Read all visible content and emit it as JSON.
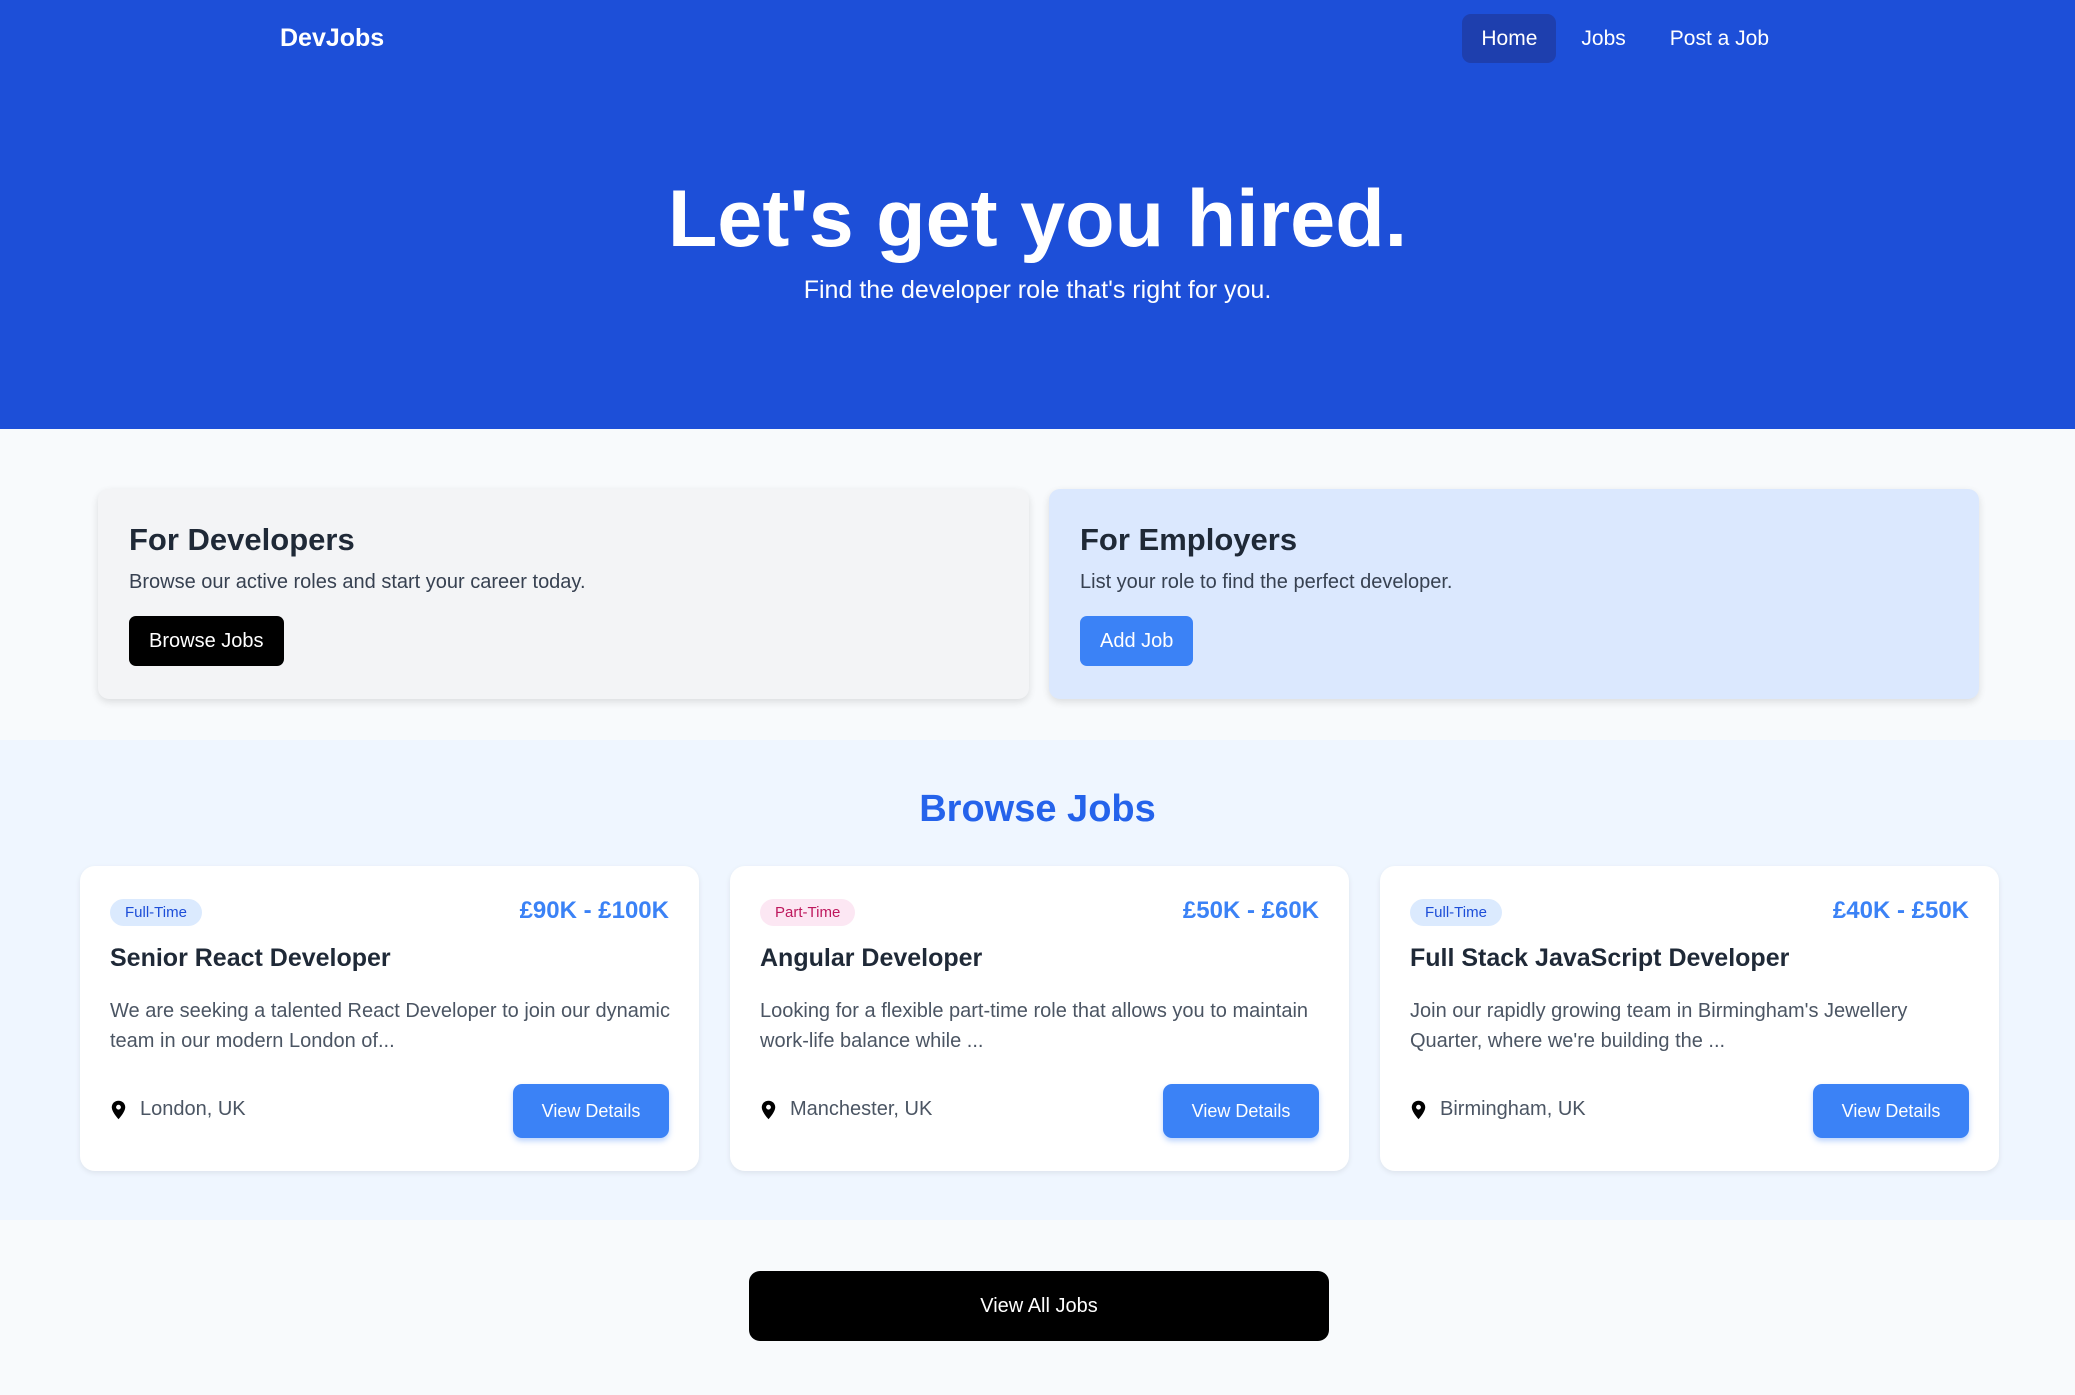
{
  "header": {
    "brand": "DevJobs",
    "nav": [
      {
        "label": "Home",
        "active": true
      },
      {
        "label": "Jobs",
        "active": false
      },
      {
        "label": "Post a Job",
        "active": false
      }
    ]
  },
  "hero": {
    "title": "Let's get you hired.",
    "subtitle": "Find the developer role that's right for you."
  },
  "roles": {
    "developers": {
      "title": "For Developers",
      "description": "Browse our active roles and start your career today.",
      "button": "Browse Jobs"
    },
    "employers": {
      "title": "For Employers",
      "description": "List your role to find the perfect developer.",
      "button": "Add Job"
    }
  },
  "browse": {
    "title": "Browse Jobs",
    "jobs": [
      {
        "type": "Full-Time",
        "salary": "£90K - £100K",
        "title": "Senior React Developer",
        "description": "We are seeking a talented React Developer to join our dynamic team in our modern London of...",
        "location": "London, UK",
        "button": "View Details"
      },
      {
        "type": "Part-Time",
        "salary": "£50K - £60K",
        "title": "Angular Developer",
        "description": "Looking for a flexible part-time role that allows you to maintain work-life balance while ...",
        "location": "Manchester, UK",
        "button": "View Details"
      },
      {
        "type": "Full-Time",
        "salary": "£40K - £50K",
        "title": "Full Stack JavaScript Developer",
        "description": "Join our rapidly growing team in Birmingham's Jewellery Quarter, where we're building the ...",
        "location": "Birmingham, UK",
        "button": "View Details"
      }
    ]
  },
  "view_all": "View All Jobs",
  "colors": {
    "primary": "#1d4fd8",
    "accent": "#3b82f6",
    "browse_bg": "#eff6ff"
  }
}
